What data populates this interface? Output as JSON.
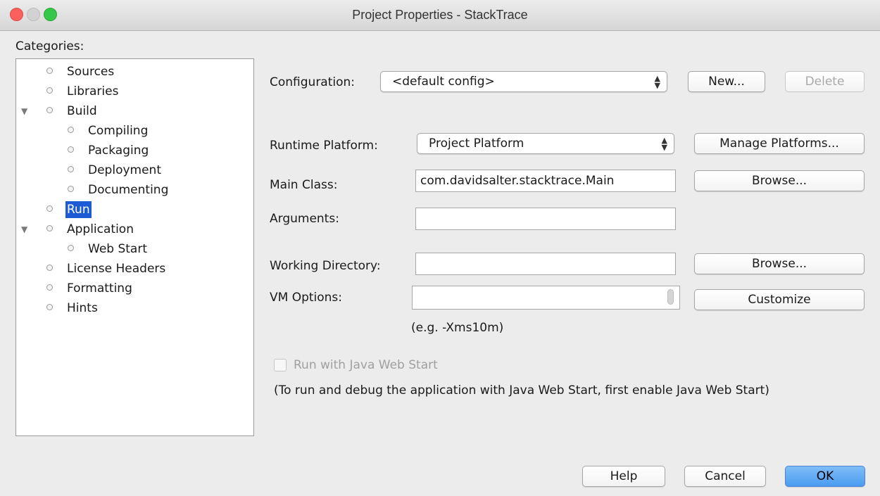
{
  "window": {
    "title": "Project Properties - StackTrace"
  },
  "categories": {
    "label": "Categories:",
    "items": [
      {
        "label": "Sources"
      },
      {
        "label": "Libraries"
      },
      {
        "label": "Build"
      },
      {
        "label": "Compiling"
      },
      {
        "label": "Packaging"
      },
      {
        "label": "Deployment"
      },
      {
        "label": "Documenting"
      },
      {
        "label": "Run"
      },
      {
        "label": "Application"
      },
      {
        "label": "Web Start"
      },
      {
        "label": "License Headers"
      },
      {
        "label": "Formatting"
      },
      {
        "label": "Hints"
      }
    ]
  },
  "form": {
    "configuration": {
      "label": "Configuration:",
      "value": "<default config>",
      "new_label": "New...",
      "delete_label": "Delete"
    },
    "runtime_platform": {
      "label": "Runtime Platform:",
      "value": "Project Platform",
      "manage_label": "Manage Platforms..."
    },
    "main_class": {
      "label": "Main Class:",
      "value": "com.davidsalter.stacktrace.Main",
      "browse_label": "Browse..."
    },
    "arguments": {
      "label": "Arguments:",
      "value": ""
    },
    "working_directory": {
      "label": "Working Directory:",
      "value": "",
      "browse_label": "Browse..."
    },
    "vm_options": {
      "label": "VM Options:",
      "value": "",
      "customize_label": "Customize",
      "hint": "(e.g. -Xms10m)"
    },
    "web_start": {
      "label": "Run with Java Web Start",
      "note": "(To run and debug the application with Java Web Start, first enable Java Web Start)"
    }
  },
  "footer": {
    "help_label": "Help",
    "cancel_label": "Cancel",
    "ok_label": "OK"
  }
}
